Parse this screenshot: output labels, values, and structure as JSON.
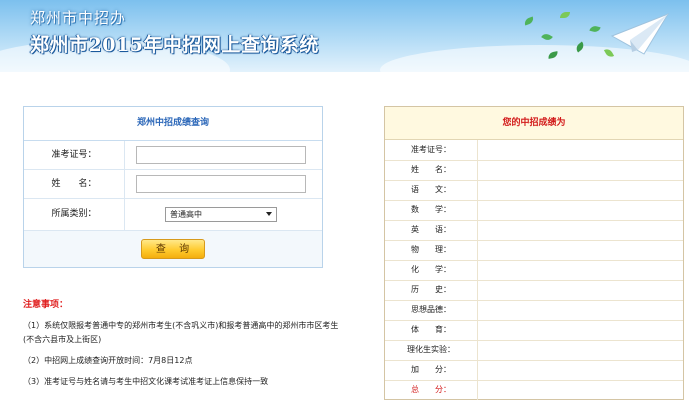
{
  "header": {
    "site_name": "郑州市中招办",
    "system_title": "郑州市2015年中招网上查询系统"
  },
  "query": {
    "title": "郑州中招成绩查询",
    "fields": [
      {
        "label": "准考证号：",
        "value": "",
        "placeholder": ""
      },
      {
        "label": "姓　　名：",
        "value": "",
        "placeholder": ""
      }
    ],
    "category_label": "所属类别：",
    "category_selected": "普通高中",
    "submit_label": "查 询"
  },
  "notes": {
    "title": "注意事项：",
    "items": [
      "（1）系统仅限报考普通中专的郑州市考生(不含巩义市)和报考普通高中的郑州市市区考生(不含六县市及上街区)",
      "（2）中招网上成绩查询开放时间：7月8日12点",
      "（3）准考证号与姓名请与考生中招文化课考试准考证上信息保持一致"
    ]
  },
  "results": {
    "title": "您的中招成绩为",
    "rows": [
      {
        "label": "准考证号：",
        "value": ""
      },
      {
        "label": "姓　　名：",
        "value": ""
      },
      {
        "label": "语　　文：",
        "value": ""
      },
      {
        "label": "数　　学：",
        "value": ""
      },
      {
        "label": "英　　语：",
        "value": ""
      },
      {
        "label": "物　　理：",
        "value": ""
      },
      {
        "label": "化　　学：",
        "value": ""
      },
      {
        "label": "历　　史：",
        "value": ""
      },
      {
        "label": "思想品德：",
        "value": ""
      },
      {
        "label": "体　　育：",
        "value": ""
      },
      {
        "label": "理化生实验：",
        "value": ""
      },
      {
        "label": "加　　分：",
        "value": ""
      },
      {
        "label": "总　　分：",
        "value": ""
      }
    ]
  },
  "colors": {
    "accent_blue": "#2a66b8",
    "alert_red": "#d21a1a",
    "button_yellow": "#ffcb2f"
  }
}
